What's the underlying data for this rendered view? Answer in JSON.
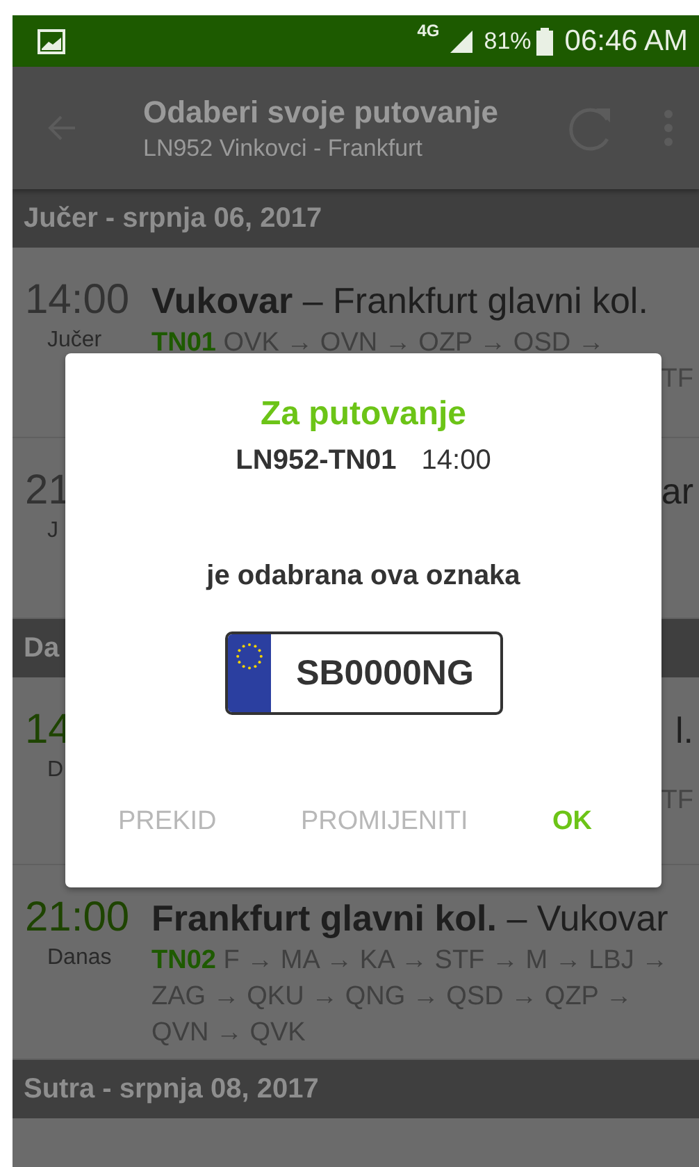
{
  "status_bar": {
    "network": "4G",
    "battery": "81%",
    "time": "06:46 AM"
  },
  "toolbar": {
    "title": "Odaberi svoje putovanje",
    "subtitle": "LN952 Vinkovci - Frankfurt"
  },
  "sections": [
    {
      "header": "Jučer - srpnja 06, 2017",
      "trips": [
        {
          "kind": "full",
          "time": "14:00",
          "day": "Jučer",
          "today": false,
          "title": "**Vukovar** – Frankfurt glavni kol.",
          "train": "TN01",
          "stops": "OVK → OVN → OZP → OSD →",
          "trailing": "TF"
        },
        {
          "kind": "partial",
          "time": "21",
          "day": "J",
          "today": false,
          "title": "ar"
        }
      ]
    },
    {
      "header": "Da",
      "trips": [
        {
          "kind": "partial",
          "time": "14",
          "day": "D",
          "today": true,
          "title": "l.",
          "trailing": "TF"
        },
        {
          "kind": "full",
          "time": "21:00",
          "day": "Danas",
          "today": true,
          "title": "**Frankfurt glavni kol.** – Vukovar",
          "train": "TN02",
          "stops": "F → MA → KA → STF → M → LBJ → ZAG → QKU → QNG → QSD → QZP → QVN → QVK"
        }
      ]
    },
    {
      "header": "Sutra - srpnja 08, 2017"
    }
  ],
  "dialog": {
    "title": "Za putovanje",
    "trip_code": "LN952-TN01",
    "trip_time": "14:00",
    "message": "je odabrana ova oznaka",
    "plate": "SB0000NG",
    "buttons": [
      {
        "label": "PREKID",
        "primary": false
      },
      {
        "label": "PROMIJENITI",
        "primary": false
      },
      {
        "label": "OK",
        "primary": true
      }
    ]
  }
}
